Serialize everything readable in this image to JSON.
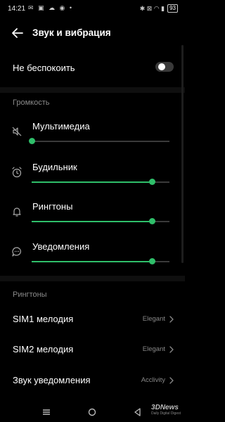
{
  "status_bar": {
    "time": "14:21",
    "left_icons": "✉ ▣ ☁ ◉ •",
    "right_icons": "✱ ⊠ ◠ ▮",
    "battery": "93"
  },
  "header": {
    "title": "Звук и вибрация"
  },
  "dnd": {
    "label": "Не беспокоить",
    "enabled": false
  },
  "volume": {
    "section_title": "Громкость",
    "items": [
      {
        "label": "Мультимедиа",
        "icon": "speaker-muted-icon",
        "level": 0.0
      },
      {
        "label": "Будильник",
        "icon": "alarm-clock-icon",
        "level": 0.87
      },
      {
        "label": "Рингтоны",
        "icon": "bell-icon",
        "level": 0.87
      },
      {
        "label": "Уведомления",
        "icon": "message-bubble-icon",
        "level": 0.87
      }
    ]
  },
  "ringtones": {
    "section_title": "Рингтоны",
    "items": [
      {
        "label": "SIM1 мелодия",
        "value": "Elegant"
      },
      {
        "label": "SIM2 мелодия",
        "value": "Elegant"
      },
      {
        "label": "Звук уведомления",
        "value": "Acclivity"
      }
    ]
  },
  "watermark": {
    "brand": "3DNews",
    "tagline": "Daily Digital Digest"
  },
  "colors": {
    "accent": "#2fbf6a",
    "background": "#000000",
    "secondary_text": "#8a8a8a"
  }
}
